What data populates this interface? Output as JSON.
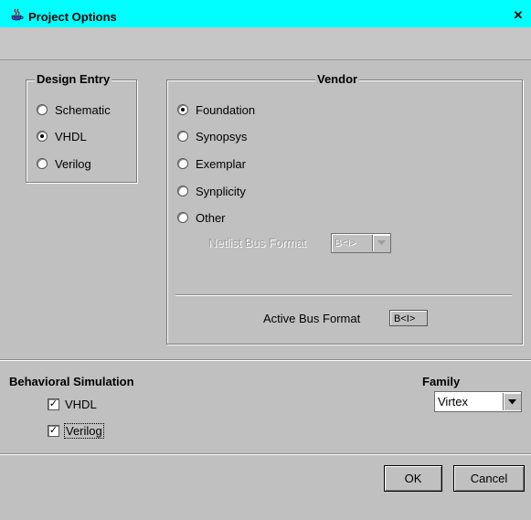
{
  "window": {
    "title": "Project Options",
    "close_glyph": "✕",
    "icon": "java-cup-icon"
  },
  "design_entry": {
    "label": "Design Entry",
    "options": [
      {
        "label": "Schematic",
        "selected": false
      },
      {
        "label": "VHDL",
        "selected": true
      },
      {
        "label": "Verilog",
        "selected": false
      }
    ]
  },
  "vendor": {
    "label": "Vendor",
    "options": [
      {
        "label": "Foundation",
        "selected": true
      },
      {
        "label": "Synopsys",
        "selected": false
      },
      {
        "label": "Exemplar",
        "selected": false
      },
      {
        "label": "Synplicity",
        "selected": false
      },
      {
        "label": "Other",
        "selected": false
      }
    ],
    "netlist_bus_format": {
      "label": "Netlist Bus Format",
      "value": "B<I>",
      "enabled": false
    },
    "active_bus_format": {
      "label": "Active Bus Format",
      "value": "B<I>"
    }
  },
  "behavioral_simulation": {
    "label": "Behavioral Simulation",
    "options": [
      {
        "label": "VHDL",
        "checked": true
      },
      {
        "label": "Verilog",
        "checked": true
      }
    ]
  },
  "family": {
    "label": "Family",
    "value": "Virtex"
  },
  "buttons": {
    "ok": "OK",
    "cancel": "Cancel"
  }
}
